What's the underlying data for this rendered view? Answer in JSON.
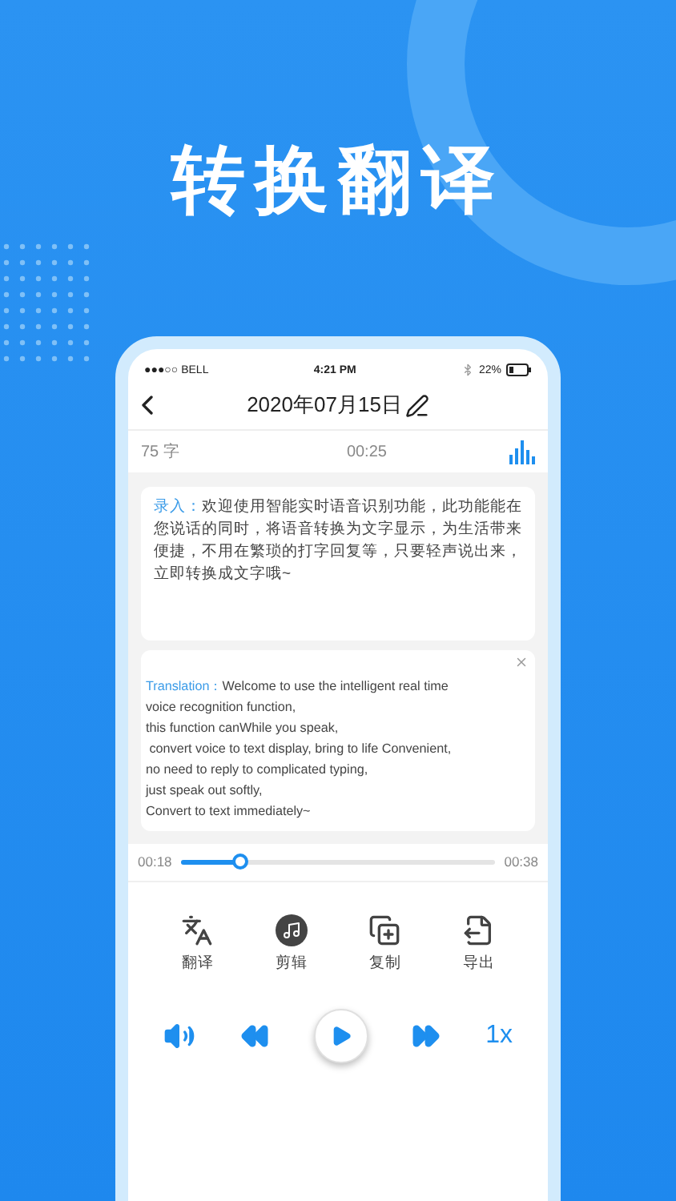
{
  "headline": "转换翻译",
  "status_bar": {
    "carrier": "●●●○○ BELL",
    "time": "4:21 PM",
    "battery": "22%"
  },
  "nav": {
    "title": "2020年07月15日"
  },
  "info": {
    "char_count": "75 字",
    "duration": "00:25"
  },
  "input": {
    "label": "录入：",
    "text": "欢迎使用智能实时语音识别功能，此功能能在您说话的同时，将语音转换为文字显示，为生活带来便捷，不用在繁琐的打字回复等，只要轻声说出来，立即转换成文字哦~"
  },
  "translation": {
    "label": "Translation：",
    "text": "Welcome to use the intelligent real time\nvoice recognition function,\nthis function canWhile you speak,\n convert voice to text display, bring to life Convenient,\nno need to reply to complicated typing,\njust speak out softly,\nConvert to text immediately~"
  },
  "progress": {
    "elapsed": "00:18",
    "total": "00:38",
    "level": 0.19
  },
  "tools": [
    {
      "kind": "translate",
      "label": "翻译"
    },
    {
      "kind": "edit",
      "label": "剪辑"
    },
    {
      "kind": "copy",
      "label": "复制"
    },
    {
      "kind": "export",
      "label": "导出"
    }
  ],
  "controls": {
    "speed": "1x"
  }
}
